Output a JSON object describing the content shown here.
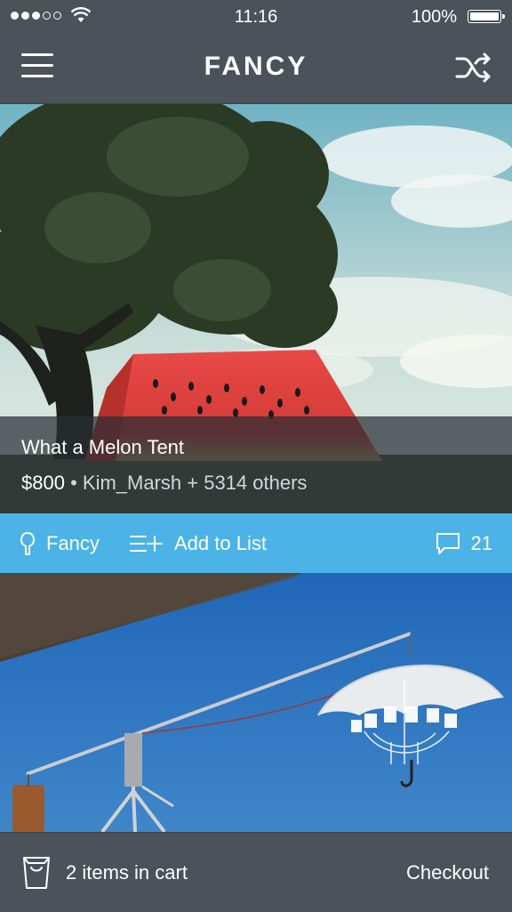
{
  "status_bar": {
    "time": "11:16",
    "battery_percent": "100%",
    "signal_bars": 3,
    "signal_total": 5,
    "battery_level": 1.0
  },
  "nav": {
    "title": "FANCY",
    "menu_icon": "hamburger-menu-icon",
    "shuffle_icon": "shuffle-icon"
  },
  "feed": {
    "items": [
      {
        "title": "What a Melon Tent",
        "price": "$800",
        "separator": "•",
        "attribution": "Kim_Marsh + 5314 others"
      }
    ]
  },
  "actions": {
    "fancy_label": "Fancy",
    "add_to_list_label": "Add to List",
    "comment_count": "21",
    "accent": "#4bb3e5"
  },
  "cart": {
    "summary": "2 items in cart",
    "checkout_label": "Checkout"
  },
  "colors": {
    "bar_background": "#4b5259",
    "accent": "#4bb3e5",
    "text": "#ffffff"
  }
}
